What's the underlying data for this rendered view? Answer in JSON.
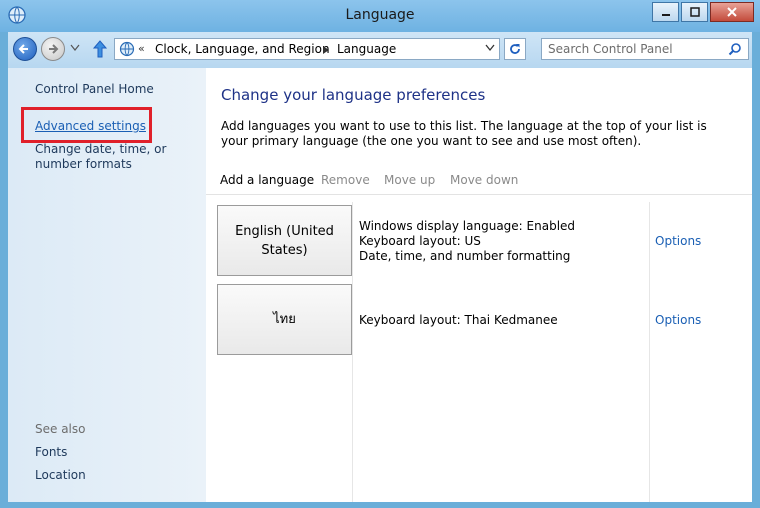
{
  "window": {
    "title": "Language"
  },
  "nav": {
    "breadcrumb": [
      "Clock, Language, and Region",
      "Language"
    ],
    "overflow_glyph": "«",
    "search_placeholder": "Search Control Panel"
  },
  "sidebar": {
    "links": [
      {
        "label": "Control Panel Home"
      },
      {
        "label": "Advanced settings"
      },
      {
        "label": "Change date, time, or number formats"
      }
    ],
    "see_also_label": "See also",
    "see_also": [
      {
        "label": "Fonts"
      },
      {
        "label": "Location"
      }
    ]
  },
  "main": {
    "title": "Change your language preferences",
    "description": "Add languages you want to use to this list. The language at the top of your list is your primary language (the one you want to see and use most often).",
    "toolbar": {
      "add": "Add a language",
      "remove": "Remove",
      "move_up": "Move up",
      "move_down": "Move down"
    },
    "languages": [
      {
        "name": "English (United States)",
        "details": [
          "Windows display language: Enabled",
          "Keyboard layout: US",
          "Date, time, and number formatting"
        ],
        "options": "Options"
      },
      {
        "name": "ไทย",
        "details": [
          "Keyboard layout: Thai Kedmanee"
        ],
        "options": "Options"
      }
    ]
  },
  "colors": {
    "accent_link": "#1a5fb4",
    "title_blue": "#1e3287",
    "highlight": "#e0202a"
  }
}
